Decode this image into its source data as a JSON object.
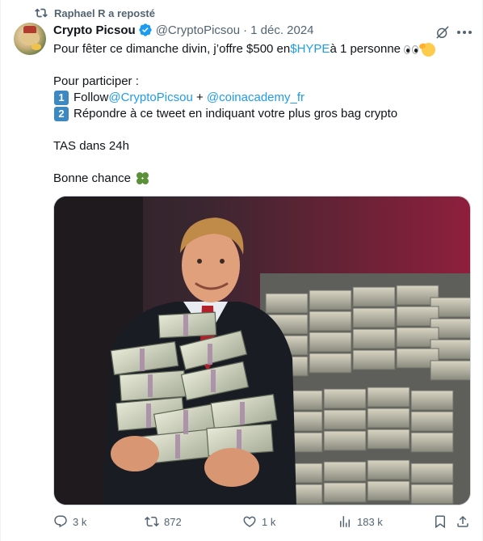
{
  "repost": {
    "text": "Raphael R a reposté",
    "icon": "repost-icon"
  },
  "author": {
    "name": "Crypto Picsou",
    "handle": "@CryptoPicsou",
    "separator": "·",
    "date": "1 déc. 2024",
    "verified": true
  },
  "tweet": {
    "line1_before": "Pour fêter ce dimanche divin, j’offre $500 en ",
    "line1_link": "$HYPE",
    "line1_after": " à 1 personne",
    "participate": "Pour participer :",
    "step1_key": "1",
    "step1_before": "Follow ",
    "step1_link1": "@CryptoPicsou",
    "step1_plus": " + ",
    "step1_link2": "@coinacademy_fr",
    "step2_key": "2",
    "step2_text": "Répondre à ce tweet en indiquant votre plus gros bag crypto",
    "tas": "TAS dans 24h",
    "luck": "Bonne chance"
  },
  "actions": {
    "replies": "3 k",
    "reposts": "872",
    "likes": "1 k",
    "views": "183 k"
  },
  "colors": {
    "link": "#1d9bf0",
    "muted": "#536471",
    "text": "#0f1419",
    "keycap": "#3b88c3"
  }
}
